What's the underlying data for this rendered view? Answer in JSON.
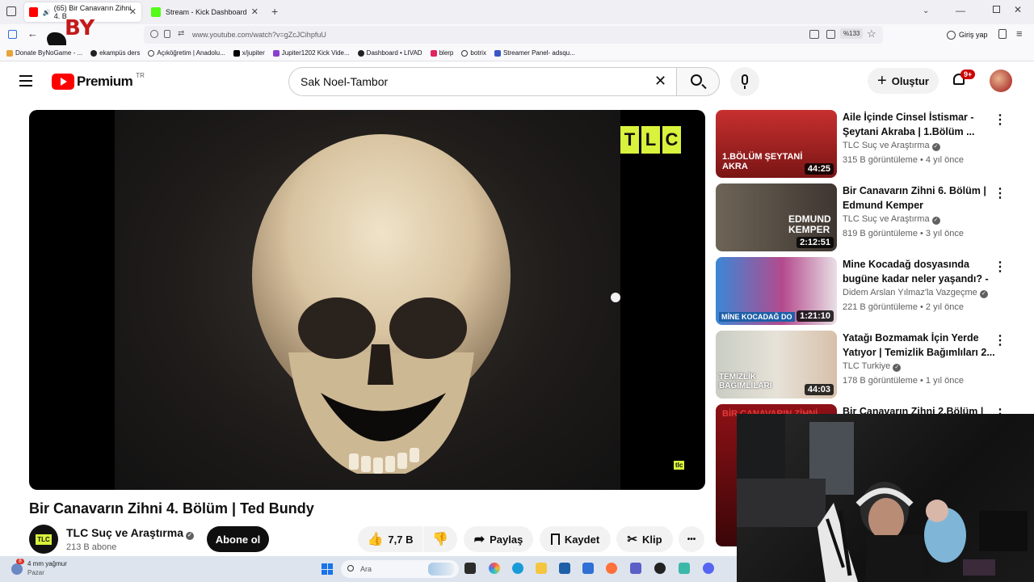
{
  "browser": {
    "tabs": [
      {
        "title": "(65) Bir Canavarın Zihni 4. B",
        "active": true
      },
      {
        "title": "Stream - Kick Dashboard",
        "active": false
      }
    ],
    "new_tab": "+",
    "url": "www.youtube.com/watch?v=gZcJCihpfuU",
    "zoom": "%133",
    "login": "Giriş yap",
    "bookmarks": [
      "Donate ByNoGame - ...",
      "ekampüs ders",
      "Açıköğretim | Anadolu...",
      "x/jupiter",
      "Jupiter1202 Kick Vide...",
      "Dashboard • LIVAD",
      "blerp",
      "botrix",
      "Streamer Panel- adsqu..."
    ]
  },
  "overlay_logo": "BY",
  "youtube": {
    "logo": "Premium",
    "region": "TR",
    "search_value": "Sak Noel-Tambor",
    "create_label": "Oluştur",
    "notif_badge": "9+"
  },
  "player": {
    "logo_letters": [
      "T",
      "L",
      "C"
    ],
    "watermark": "tlc"
  },
  "video": {
    "title": "Bir Canavarın Zihni 4. Bölüm | Ted Bundy",
    "channel": "TLC Suç ve Araştırma",
    "channel_logo": "TLC",
    "subscribers": "213 B abone",
    "subscribe_label": "Abone ol",
    "likes": "7,7 B",
    "share_label": "Paylaş",
    "save_label": "Kaydet",
    "clip_label": "Klip",
    "more_label": "•••"
  },
  "recommendations": [
    {
      "title": "Aile İçinde Cinsel İstismar - Şeytani Akraba | 1.Bölüm ...",
      "channel": "TLC Suç ve Araştırma",
      "meta": "315 B görüntüleme • 4 yıl önce",
      "duration": "44:25",
      "thumb_text": "1.BÖLÜM ŞEYTANİ AKRA",
      "color": "#b8202a"
    },
    {
      "title": "Bir Canavarın Zihni 6. Bölüm | Edmund Kemper",
      "channel": "TLC Suç ve Araştırma",
      "meta": "819 B görüntüleme • 3 yıl önce",
      "duration": "2:12:51",
      "thumb_text": "EDMUND KEMPER",
      "color": "#5a5046"
    },
    {
      "title": "Mine Kocadağ dosyasında bugüne kadar neler yaşandı? - 3",
      "channel": "Didem Arslan Yılmaz'la Vazgeçme",
      "meta": "221 B görüntüleme • 2 yıl önce",
      "duration": "1:21:10",
      "thumb_text": "MİNE KOCADAĞ DO",
      "color": "#2f6fb3"
    },
    {
      "title": "Yatağı Bozmamak İçin Yerde Yatıyor | Temizlik Bağımlıları 2...",
      "channel": "TLC Turkiye",
      "meta": "178 B görüntüleme • 1 yıl önce",
      "duration": "44:03",
      "thumb_text": "TEMİZLİK BAĞIMLILARI",
      "color": "#8a9a88"
    },
    {
      "title": "Bir Canavarın Zihni 2.Bölüm |",
      "channel": "",
      "meta": "",
      "duration": "",
      "thumb_text": "BİR CANAVARIN ZİHNİ",
      "color": "#7a0f14"
    }
  ],
  "taskbar": {
    "weather": "4 mm yağmur",
    "weather_day": "Pazar",
    "weather_badge": "8",
    "search_placeholder": "Ara"
  }
}
